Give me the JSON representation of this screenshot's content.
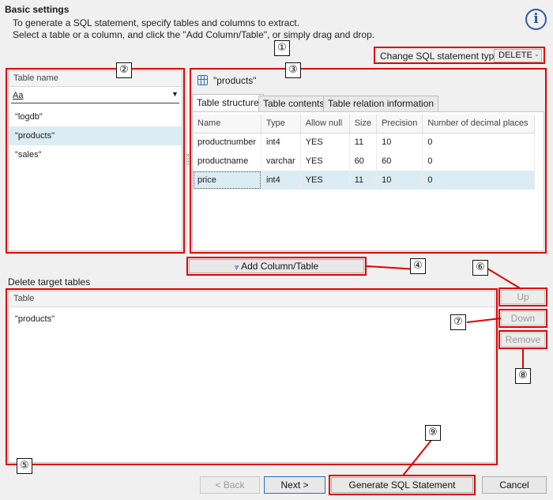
{
  "header": {
    "title": "Basic settings",
    "line1": "To generate a SQL statement, specify tables and columns to extract.",
    "line2": "Select a table or a column, and click the \"Add Column/Table\", or simply drag and drop."
  },
  "info_icon": "i",
  "sql_type": {
    "label": "Change SQL statement type:",
    "value": "DELETE"
  },
  "callouts": [
    "①",
    "②",
    "③",
    "④",
    "⑤",
    "⑥",
    "⑦",
    "⑧",
    "⑨"
  ],
  "table_list": {
    "header": "Table name",
    "filter": "Aa",
    "items": [
      "\"logdb\"",
      "\"products\"",
      "\"sales\""
    ],
    "selected_index": 1
  },
  "detail": {
    "title": "\"products\"",
    "tabs": [
      "Table structure",
      "Table contents",
      "Table relation information"
    ],
    "columns": [
      "Name",
      "Type",
      "Allow null",
      "Size",
      "Precision",
      "Number of decimal places"
    ],
    "rows": [
      [
        "productnumber",
        "int4",
        "YES",
        "11",
        "10",
        "0"
      ],
      [
        "productname",
        "varchar",
        "YES",
        "60",
        "60",
        "0"
      ],
      [
        "price",
        "int4",
        "YES",
        "11",
        "10",
        "0"
      ]
    ]
  },
  "add_button": "Add Column/Table",
  "delete_targets": {
    "label": "Delete target tables",
    "header": "Table",
    "items": [
      "\"products\""
    ]
  },
  "side_buttons": {
    "up": "Up",
    "down": "Down",
    "remove": "Remove"
  },
  "footer": {
    "back": "< Back",
    "next": "Next >",
    "generate": "Generate SQL Statement",
    "cancel": "Cancel"
  }
}
